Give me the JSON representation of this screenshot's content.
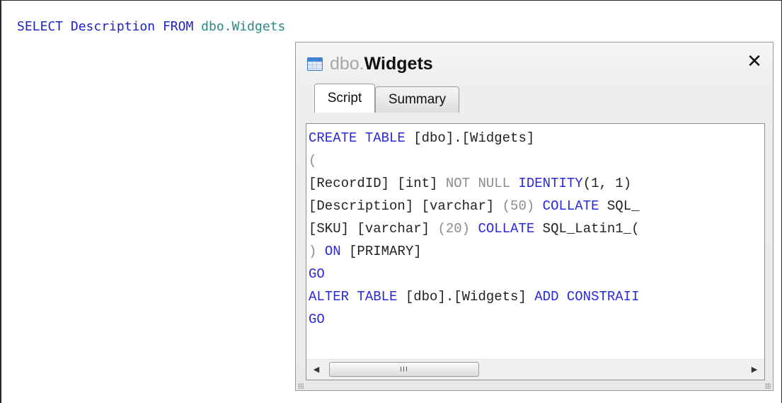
{
  "editor": {
    "query": [
      {
        "text": "SELECT",
        "kind": "kw"
      },
      {
        "text": " ",
        "kind": "id"
      },
      {
        "text": "Description",
        "kind": "kw"
      },
      {
        "text": " ",
        "kind": "id"
      },
      {
        "text": "FROM",
        "kind": "kw"
      },
      {
        "text": " ",
        "kind": "id"
      },
      {
        "text": "dbo.Widgets",
        "kind": "obj"
      }
    ]
  },
  "popup": {
    "title_schema": "dbo.",
    "title_name": "Widgets",
    "close_label": "✕",
    "tabs": {
      "script": "Script",
      "summary": "Summary"
    },
    "script_lines": [
      [
        {
          "t": "CREATE TABLE",
          "c": "k"
        },
        {
          "t": " [dbo].[Widgets]",
          "c": "t"
        }
      ],
      [
        {
          "t": "(",
          "c": "g"
        }
      ],
      [
        {
          "t": "[RecordID] [int] ",
          "c": "t"
        },
        {
          "t": "NOT NULL ",
          "c": "g"
        },
        {
          "t": "IDENTITY",
          "c": "k"
        },
        {
          "t": "(1, 1)",
          "c": "t"
        }
      ],
      [
        {
          "t": "[Description] [varchar] ",
          "c": "t"
        },
        {
          "t": "(50) ",
          "c": "g"
        },
        {
          "t": "COLLATE",
          "c": "k"
        },
        {
          "t": " SQL_",
          "c": "t"
        }
      ],
      [
        {
          "t": "[SKU] [varchar] ",
          "c": "t"
        },
        {
          "t": "(20) ",
          "c": "g"
        },
        {
          "t": "COLLATE",
          "c": "k"
        },
        {
          "t": " SQL_Latin1_(",
          "c": "t"
        }
      ],
      [
        {
          "t": ") ",
          "c": "g"
        },
        {
          "t": "ON",
          "c": "k"
        },
        {
          "t": " [PRIMARY]",
          "c": "t"
        }
      ],
      [
        {
          "t": "GO",
          "c": "k"
        }
      ],
      [
        {
          "t": "ALTER TABLE",
          "c": "k"
        },
        {
          "t": " [dbo].[Widgets] ",
          "c": "t"
        },
        {
          "t": "ADD CONSTRAII",
          "c": "k"
        }
      ],
      [
        {
          "t": "GO",
          "c": "k"
        }
      ]
    ],
    "scrollbar": {
      "left_arrow": "◀",
      "right_arrow": "▶",
      "grip": "III"
    }
  }
}
